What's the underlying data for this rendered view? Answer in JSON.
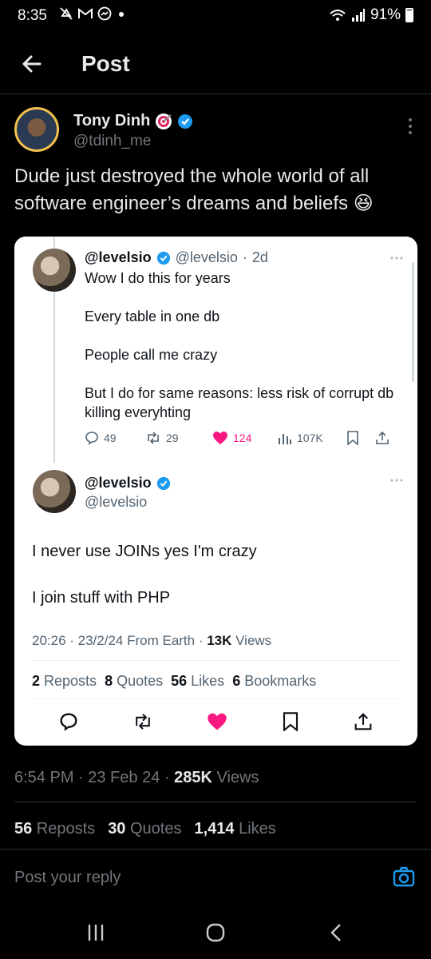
{
  "status_bar": {
    "time": "8:35",
    "battery": "91%",
    "icons": [
      "mute-icon",
      "gmail-icon",
      "messenger-icon",
      "dot-icon",
      "wifi-icon",
      "signal-icon",
      "battery-icon"
    ]
  },
  "header": {
    "title": "Post"
  },
  "post": {
    "author_name": "Tony Dinh",
    "author_handle": "@tdinh_me",
    "text": "Dude just destroyed the whole world of all software engineer’s dreams and beliefs 😆",
    "timestamp": "6:54 PM · 23 Feb 24 · ",
    "views_count": "285K",
    "views_label": " Views",
    "stats": {
      "reposts_count": "56",
      "reposts_label": " Reposts",
      "quotes_count": "30",
      "quotes_label": " Quotes",
      "likes_count": "1,414",
      "likes_label": " Likes"
    }
  },
  "quoted": {
    "parent": {
      "name": "@levelsio",
      "handle": "@levelsio",
      "sep": "·",
      "time": "2d",
      "lines": [
        "Wow I do this for years",
        "Every table in one db",
        "People call me crazy",
        "But I do for same reasons: less risk of corrupt db killing everyhting"
      ],
      "replies": "49",
      "reposts": "29",
      "likes": "124",
      "views": "107K"
    },
    "main": {
      "name": "@levelsio",
      "handle": "@levelsio",
      "lines": [
        "I never use JOINs yes I'm crazy",
        "I join stuff with PHP"
      ],
      "meta_prefix": "20:26 · 23/2/24 From Earth · ",
      "views_count": "13K",
      "views_label": " Views",
      "reposts_count": "2",
      "reposts_label": " Reposts",
      "quotes_count": "8",
      "quotes_label": " Quotes",
      "likes_count": "56",
      "likes_label": " Likes",
      "bookmarks_count": "6",
      "bookmarks_label": " Bookmarks"
    }
  },
  "reply": {
    "placeholder": "Post your reply"
  },
  "colors": {
    "accent": "#1d9bf0",
    "like": "#f91880",
    "background": "#000000",
    "card": "#ffffff"
  }
}
